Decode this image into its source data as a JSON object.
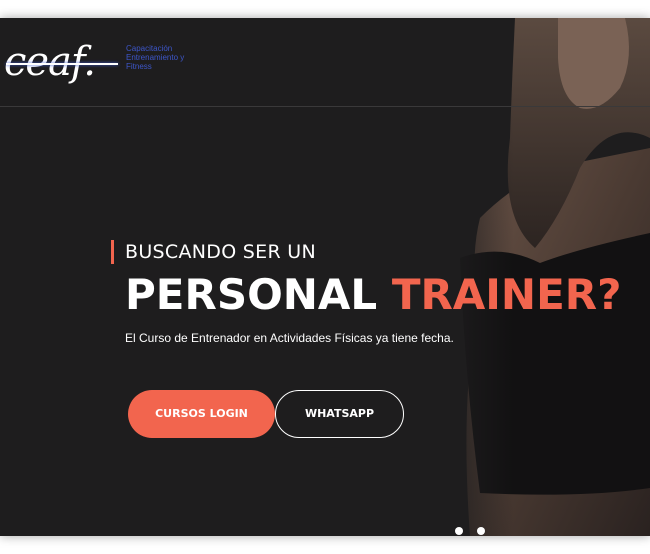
{
  "brand": {
    "logo_mark": "ceaf.",
    "tagline_lines": [
      "Capacitación",
      "Entrenamiento y",
      "Fitness"
    ]
  },
  "hero": {
    "eyebrow": "BUSCANDO SER UN",
    "headline_plain": "PERSONAL",
    "headline_accent": "TRAINER?",
    "subtitle": "El Curso de Entrenador en Actividades Físicas ya tiene fecha."
  },
  "actions": {
    "primary_label": "CURSOS LOGIN",
    "secondary_label": "WHATSAPP"
  },
  "colors": {
    "accent": "#f2654e",
    "background": "#1e1d1e",
    "logo_text": "#3d56c9"
  }
}
